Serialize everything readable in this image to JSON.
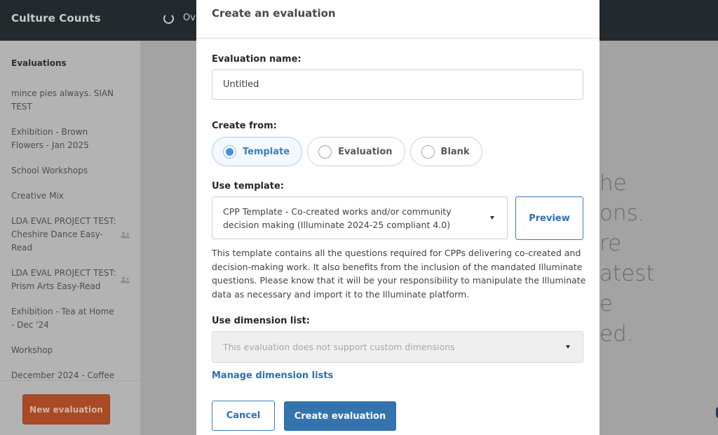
{
  "app": {
    "brand": "Culture Counts",
    "nav": {
      "icon": "loading-spinner-icon",
      "label": "Ov"
    }
  },
  "sidebar": {
    "title": "Evaluations",
    "items": [
      {
        "label": "mince pies always. SIAN TEST",
        "shared": false
      },
      {
        "label": "Exhibition - Brown Flowers - Jan 2025",
        "shared": false
      },
      {
        "label": "School Workshops",
        "shared": false
      },
      {
        "label": "Creative Mix",
        "shared": false
      },
      {
        "label": "LDA EVAL PROJECT TEST: Cheshire Dance Easy-Read",
        "shared": true
      },
      {
        "label": "LDA EVAL PROJECT TEST: Prism Arts Easy-Read",
        "shared": true
      },
      {
        "label": "Exhibition - Tea at Home - Dec '24",
        "shared": false
      },
      {
        "label": "Workshop",
        "shared": false
      },
      {
        "label": "December 2024 - Coffee",
        "shared": false
      }
    ],
    "new_button": "New evaluation"
  },
  "background": {
    "text_fragment": "he\nons.\nre\natest\ne\ned."
  },
  "modal": {
    "title": "Create an evaluation",
    "name_label": "Evaluation name:",
    "name_value": "Untitled",
    "create_from_label": "Create from:",
    "create_from_options": [
      {
        "label": "Template",
        "selected": true
      },
      {
        "label": "Evaluation",
        "selected": false
      },
      {
        "label": "Blank",
        "selected": false
      }
    ],
    "template_label": "Use template:",
    "template_value": "CPP Template - Co-created works and/or community decision making (Illuminate 2024-25 compliant 4.0)",
    "preview_button": "Preview",
    "template_description": "This template contains all the questions required for CPPs delivering co-created and decision-making work. It also benefits from the inclusion of the mandated Illuminate questions. Please know that it will be your responsibility to manipulate the Illuminate data as necessary and import it to the Illuminate platform.",
    "dimension_label": "Use dimension list:",
    "dimension_value": "This evaluation does not support custom dimensions",
    "manage_link": "Manage dimension lists",
    "cancel_button": "Cancel",
    "create_button": "Create evaluation"
  },
  "colors": {
    "topbar": "#232a2e",
    "primary_blue": "#3473ad",
    "new_button": "#a84a25",
    "radio_selected": "#4a8fe0"
  }
}
